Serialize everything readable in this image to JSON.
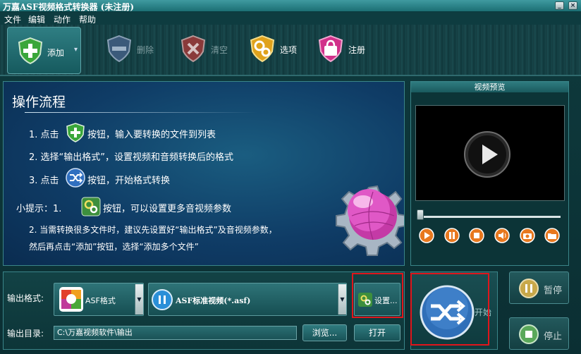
{
  "window": {
    "title": "万嘉ASF视频格式转换器  (未注册)",
    "minimize": "_",
    "close": "×"
  },
  "menu": [
    "文件",
    "编辑",
    "动作",
    "帮助"
  ],
  "toolbar": {
    "add_label": "添加",
    "add_arrow": "▾",
    "delete_label": "删除",
    "clear_label": "清空",
    "options_label": "选项",
    "register_label": "注册"
  },
  "process": {
    "title": "操作流程",
    "step1_a": "1. 点击",
    "step1_b": "按钮，输入要转换的文件到列表",
    "step2": "2. 选择“输出格式”，设置视频和音频转换后的格式",
    "step3_a": "3. 点击",
    "step3_b": "按钮，开始格式转换",
    "tip_label": "小提示：1.",
    "tip1_b": "按钮，可以设置更多音视频参数",
    "tip2_line1": "2. 当需转换很多文件时，建议先设置好“输出格式”及音视频参数，",
    "tip2_line2": "然后再点击“添加”按钮，选择“添加多个文件”"
  },
  "preview": {
    "title": "视频预览"
  },
  "output": {
    "format_label": "输出格式:",
    "format_value": "ASF格式",
    "profile_value": "ASF标准视频(*.asf)",
    "settings_label": "设置...",
    "dir_label": "输出目录:",
    "dir_value": "C:\\万嘉视频软件\\输出",
    "browse_label": "浏览...",
    "open_label": "打开"
  },
  "actions": {
    "start_label": "开始",
    "pause_label": "暂停",
    "stop_label": "停止"
  },
  "colors": {
    "accent": "#1c6f74",
    "highlight_box": "#e0151b",
    "panel": "#0f3c66"
  }
}
